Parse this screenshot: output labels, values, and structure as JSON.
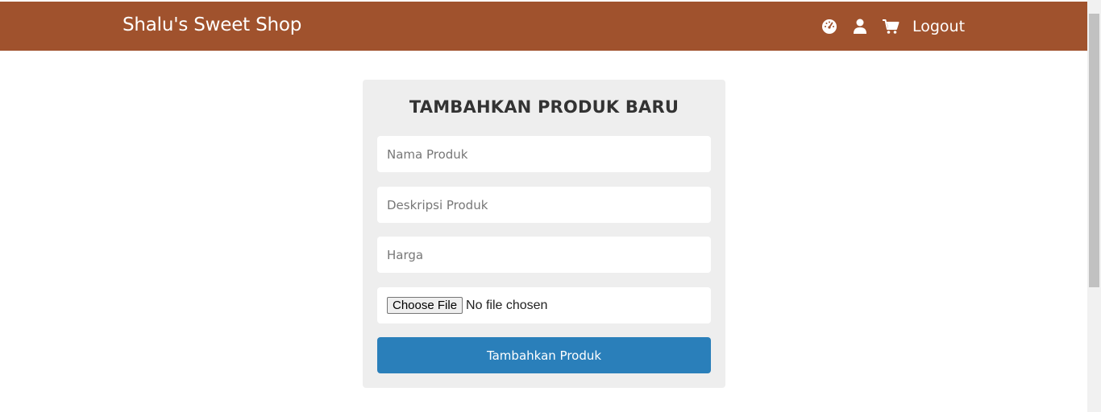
{
  "navbar": {
    "brand": "Shalu's Sweet Shop",
    "icons": [
      "dashboard-icon",
      "user-icon",
      "cart-icon"
    ],
    "logout_label": "Logout",
    "background": "#a0522d"
  },
  "form": {
    "title": "TAMBAHKAN PRODUK BARU",
    "name_placeholder": "Nama Produk",
    "description_placeholder": "Deskripsi Produk",
    "price_placeholder": "Harga",
    "file_button_label": "Choose File",
    "file_status": "No file chosen",
    "submit_label": "Tambahkan Produk",
    "submit_color": "#2a7fba",
    "card_background": "#eeeeee"
  }
}
